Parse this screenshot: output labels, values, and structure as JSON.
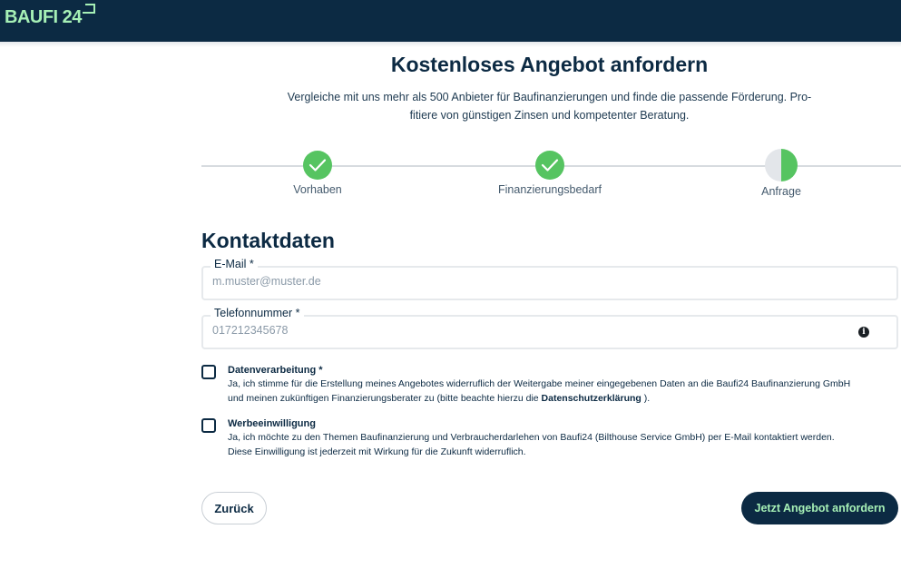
{
  "header": {
    "logo_text": "BAUFI 24",
    "background_color": "#0c2a43",
    "logo_color": "#a6f0b6"
  },
  "main": {
    "title": "Kostenloses Angebot anfordern",
    "subtitle_line1": "Vergleiche mit uns mehr als 500 Anbieter für Baufinanzierungen und finde die passende Förderung. Pro-",
    "subtitle_line2": "fitiere von günstigen Zinsen und kompetenter Beratung."
  },
  "stepper": {
    "steps": [
      {
        "label": "Vorhaben",
        "state": "complete",
        "icon": "checkmark-icon"
      },
      {
        "label": "Finanzierungsbedarf",
        "state": "complete",
        "icon": "checkmark-icon"
      },
      {
        "label": "Anfrage",
        "state": "current",
        "icon": "half-circle-icon"
      }
    ],
    "complete_color": "#56c461"
  },
  "form": {
    "section_title": "Kontaktdaten",
    "email": {
      "label": "E-Mail *",
      "value": "",
      "placeholder": "m.muster@muster.de"
    },
    "phone": {
      "label": "Telefonnummer *",
      "value": "",
      "placeholder": "017212345678",
      "icon": "info-icon"
    },
    "consents": [
      {
        "title": "Datenverarbeitung *",
        "text_line1": "Ja, ich stimme für die Erstellung meines Angebotes widerruflich der Weitergabe meiner eingegebenen Daten an die Baufi24 Baufinanzierung GmbH",
        "text_line2_prefix": "und meinen zukünftigen Finanzierungsberater zu (bitte beachte hierzu die ",
        "text_line2_link": "Datenschutzerklärung",
        "text_line2_suffix": " ).",
        "checked": false
      },
      {
        "title": "Werbeeinwilligung",
        "text_line1": "Ja, ich möchte zu den Themen Baufinanzierung und Verbraucherdarlehen von Baufi24 (Bilthouse Service GmbH) per E-Mail kontaktiert werden.",
        "text_line2": "Diese Einwilligung ist jederzeit mit Wirkung für die Zukunft widerruflich.",
        "checked": false
      }
    ]
  },
  "actions": {
    "back_label": "Zurück",
    "submit_label": "Jetzt Angebot anfordern"
  }
}
